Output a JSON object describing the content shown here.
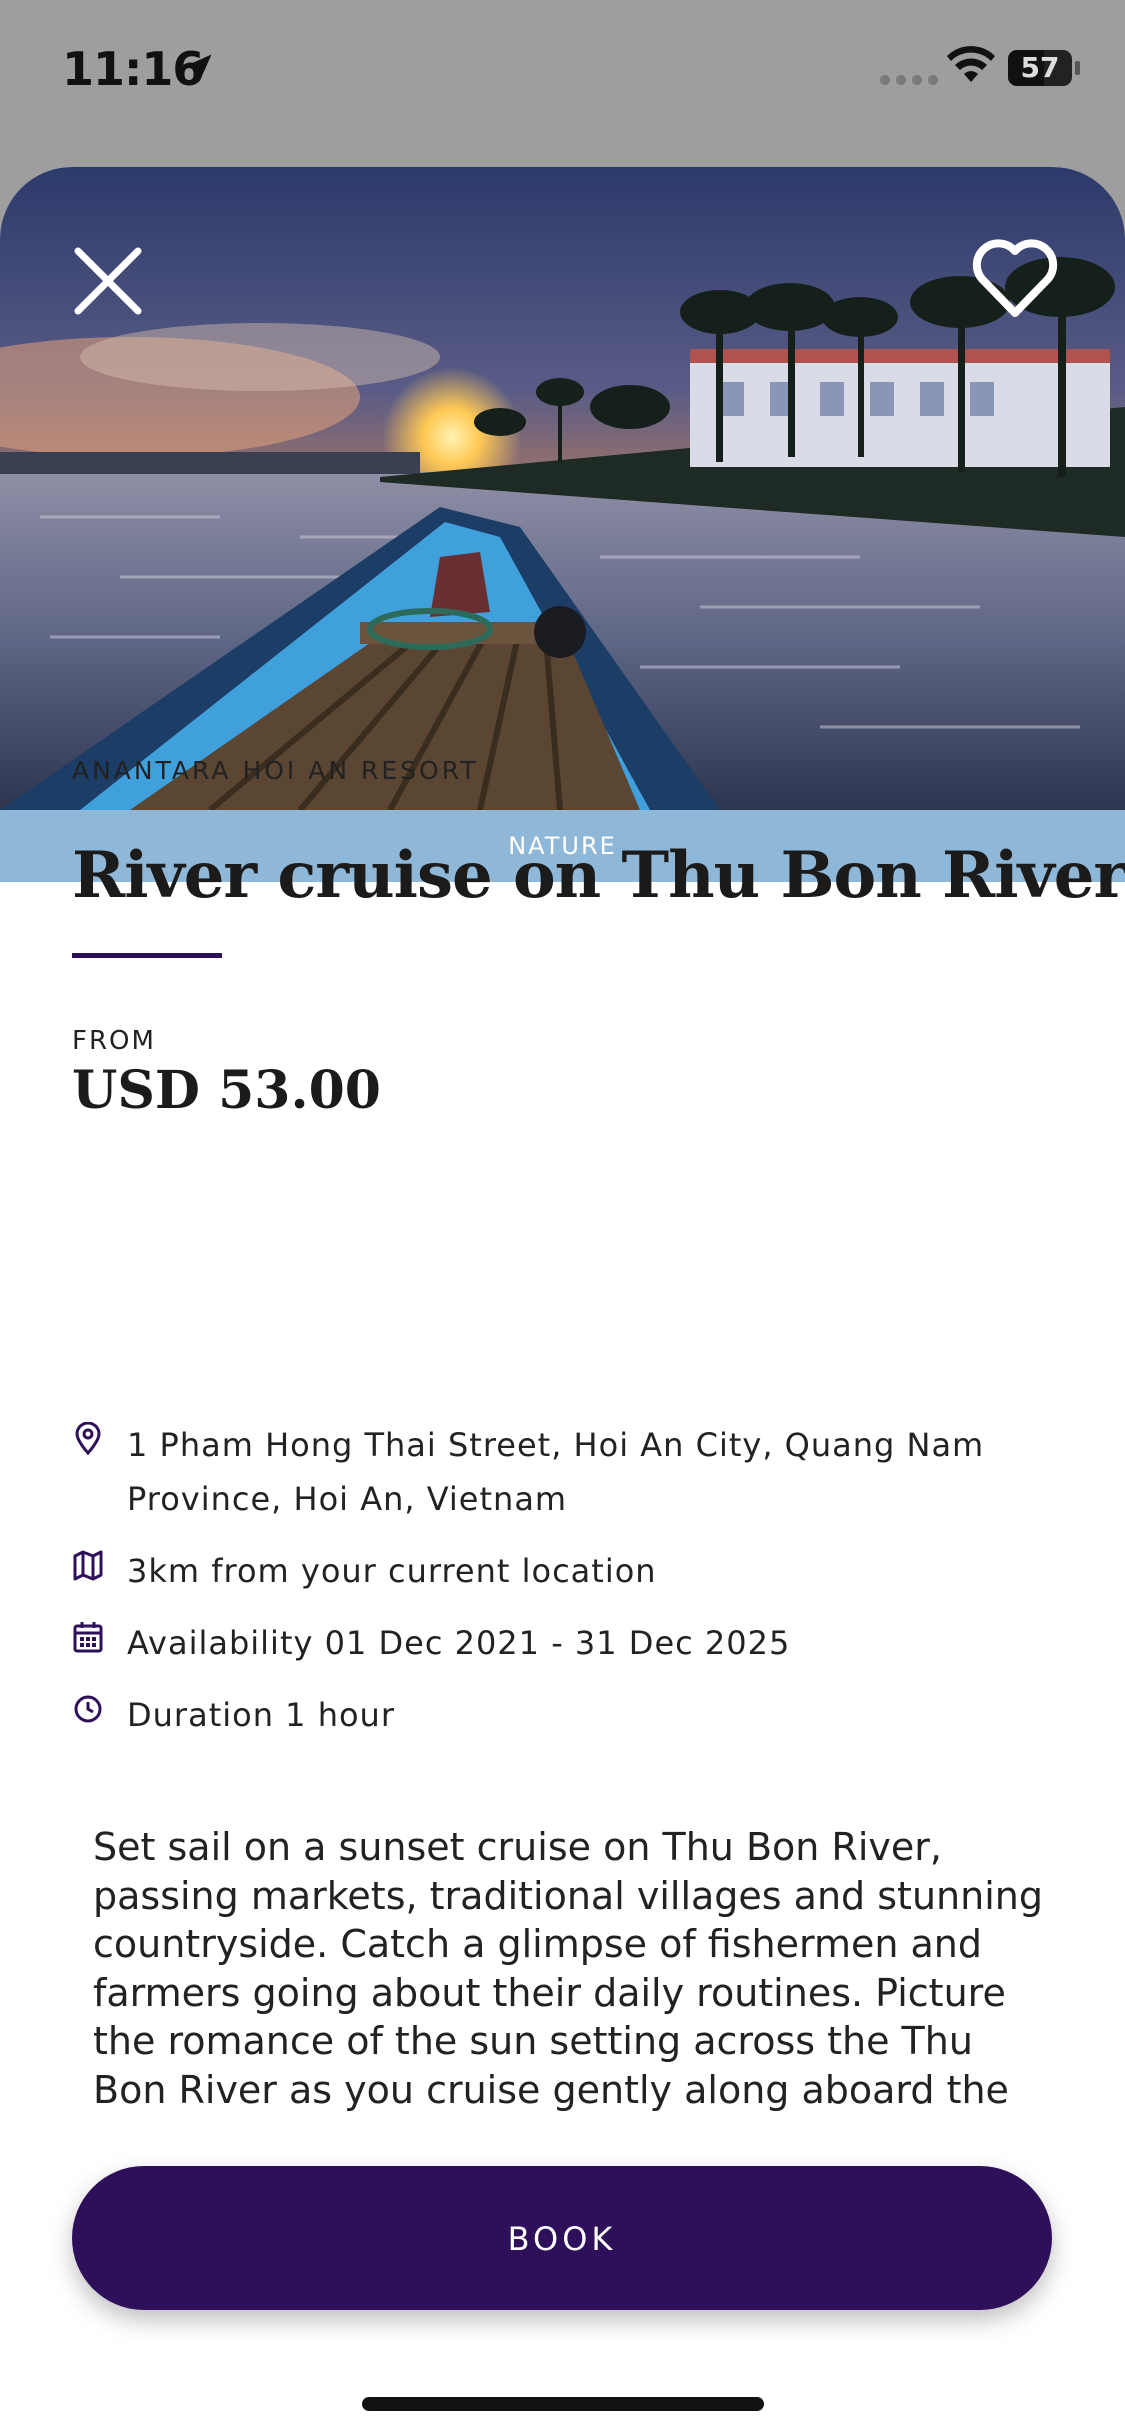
{
  "status_bar": {
    "time": "11:16",
    "battery": "57",
    "battery_level": 0.57
  },
  "hero": {
    "close_icon": "close-icon",
    "favorite_icon": "heart-icon"
  },
  "category": "NATURE",
  "resort": "ANANTARA HOI AN RESORT",
  "title": "River cruise on Thu Bon River",
  "price": {
    "from_label": "FROM",
    "value": "USD 53.00"
  },
  "details": [
    {
      "icon": "location-pin-icon",
      "text": "1 Pham Hong Thai Street, Hoi An City, Quang Nam Province, Hoi An, Vietnam"
    },
    {
      "icon": "map-icon",
      "text": "3km from your current location"
    },
    {
      "icon": "calendar-icon",
      "text": "Availability 01 Dec 2021 - 31 Dec 2025"
    },
    {
      "icon": "clock-icon",
      "text": "Duration 1 hour"
    }
  ],
  "description": "Set sail on a sunset cruise on Thu Bon River, passing markets, traditional villages and stunning countryside. Catch a glimpse of fishermen and farmers going about their daily routines. Picture the romance of the sun setting across the Thu Bon River as you cruise gently along aboard the Anantara",
  "book_label": "BOOK",
  "colors": {
    "accent": "#2e0f5a",
    "category_band": "#8fb8d8"
  }
}
